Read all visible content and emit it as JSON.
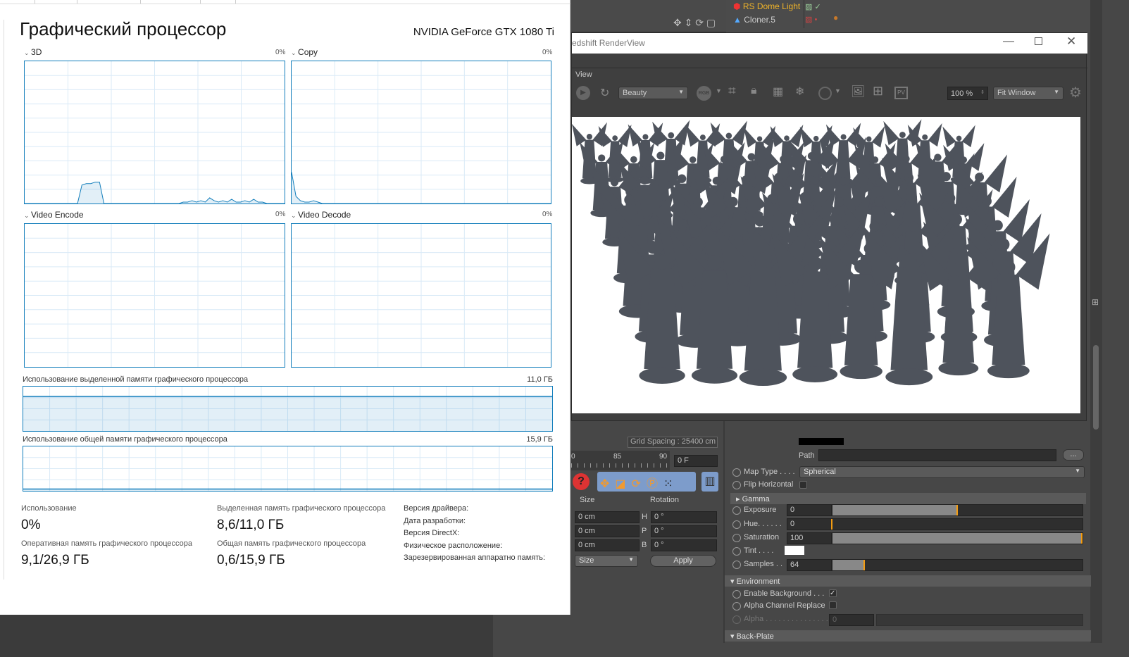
{
  "task_manager": {
    "title": "Графический процессор",
    "gpu_name": "NVIDIA GeForce GTX 1080 Ti",
    "engines": [
      {
        "label": "3D",
        "percent": "0%",
        "history": [
          0,
          0,
          0,
          0,
          0,
          0,
          0,
          0,
          0,
          0,
          0,
          0,
          0,
          13,
          14,
          14,
          15,
          15,
          0,
          0,
          0,
          0,
          0,
          0,
          0,
          0,
          0,
          0,
          0,
          0,
          0,
          0,
          0,
          0,
          0,
          0,
          1,
          1,
          2,
          1,
          2,
          1,
          4,
          2,
          1,
          2,
          1,
          3,
          1,
          1,
          2,
          1,
          3,
          1,
          1,
          0,
          0,
          0,
          0,
          0
        ]
      },
      {
        "label": "Copy",
        "percent": "0%",
        "history": [
          22,
          5,
          2,
          1,
          1,
          2,
          1,
          0,
          0,
          0,
          0,
          0,
          0,
          0,
          0,
          0,
          0,
          0,
          0,
          0,
          0,
          0,
          0,
          0,
          0,
          0,
          0,
          0,
          0,
          0,
          0,
          0,
          0,
          0,
          0,
          0,
          0,
          0,
          0,
          0,
          0,
          0,
          0,
          0,
          0,
          0,
          0,
          0,
          0,
          0,
          0,
          0,
          0,
          0,
          0,
          0,
          0,
          0,
          0,
          0
        ]
      },
      {
        "label": "Video Encode",
        "percent": "0%",
        "history": []
      },
      {
        "label": "Video Decode",
        "percent": "0%",
        "history": []
      }
    ],
    "dedicated_memory": {
      "label": "Использование выделенной памяти графического процессора",
      "max": "11,0 ГБ",
      "fraction": 0.78
    },
    "shared_memory": {
      "label": "Использование общей памяти графического процессора",
      "max": "15,9 ГБ",
      "fraction": 0.04
    },
    "stats": {
      "usage_label": "Использование",
      "usage_value": "0%",
      "ram_label": "Оперативная память графического процессора",
      "ram_value": "9,1/26,9 ГБ",
      "dedicated_label": "Выделенная память графического процессора",
      "dedicated_value": "8,6/11,0 ГБ",
      "shared_label": "Общая память графического процессора",
      "shared_value": "0,6/15,9 ГБ"
    },
    "info_labels": [
      "Версия драйвера:",
      "Дата разработки:",
      "Версия DirectX:",
      "Физическое расположение:",
      "Зарезервированная аппаратно память:"
    ]
  },
  "objects": [
    {
      "name": "RS Dome Light",
      "color": "#f0b429"
    },
    {
      "name": "Cloner.5",
      "color": "#cccccc"
    }
  ],
  "renderview": {
    "title": "edshift RenderView",
    "menu": "View",
    "aov": "Beauty",
    "rgb": "RGB",
    "pv": "PV",
    "zoom": "100 %",
    "fit": "Fit Window"
  },
  "coords": {
    "grid_spacing": "Grid Spacing : 25400 cm",
    "ruler": [
      "0",
      "85",
      "90"
    ],
    "frame": "0 F",
    "size_header": "Size",
    "rotation_header": "Rotation",
    "sizes": [
      "0 cm",
      "0 cm",
      "0 cm"
    ],
    "rot_labels": [
      "H",
      "P",
      "B"
    ],
    "rotations": [
      "0 °",
      "0 °",
      "0 °"
    ],
    "mode": "Size",
    "apply": "Apply"
  },
  "attributes": {
    "path_label": "Path",
    "browse": "...",
    "map_type_label": "Map Type . . . .",
    "map_type": "Spherical",
    "flip_label": "Flip Horizontal",
    "gamma": "Gamma",
    "exposure_label": "Exposure",
    "exposure": "0",
    "hue_label": "Hue. . . . . .",
    "hue": "0",
    "saturation_label": "Saturation",
    "saturation": "100",
    "tint_label": "Tint . . . .",
    "samples_label": "Samples . .",
    "samples": "64",
    "environment": "Environment",
    "enable_bg_label": "Enable Background . . .",
    "enable_bg": true,
    "alpha_replace_label": "Alpha Channel Replace",
    "alpha_label": "Alpha . . . . . . . . . . . . . . .",
    "alpha": "0",
    "backplate": "Back-Plate",
    "slider_levels": {
      "exposure": 0.5,
      "hue": 0.0,
      "saturation": 1.0,
      "samples": 0.13
    }
  },
  "colors": {
    "accent": "#117dbb",
    "grid": "#d9eaf7",
    "slider_mark": "#f39c12",
    "c4d_bg": "#474747"
  }
}
